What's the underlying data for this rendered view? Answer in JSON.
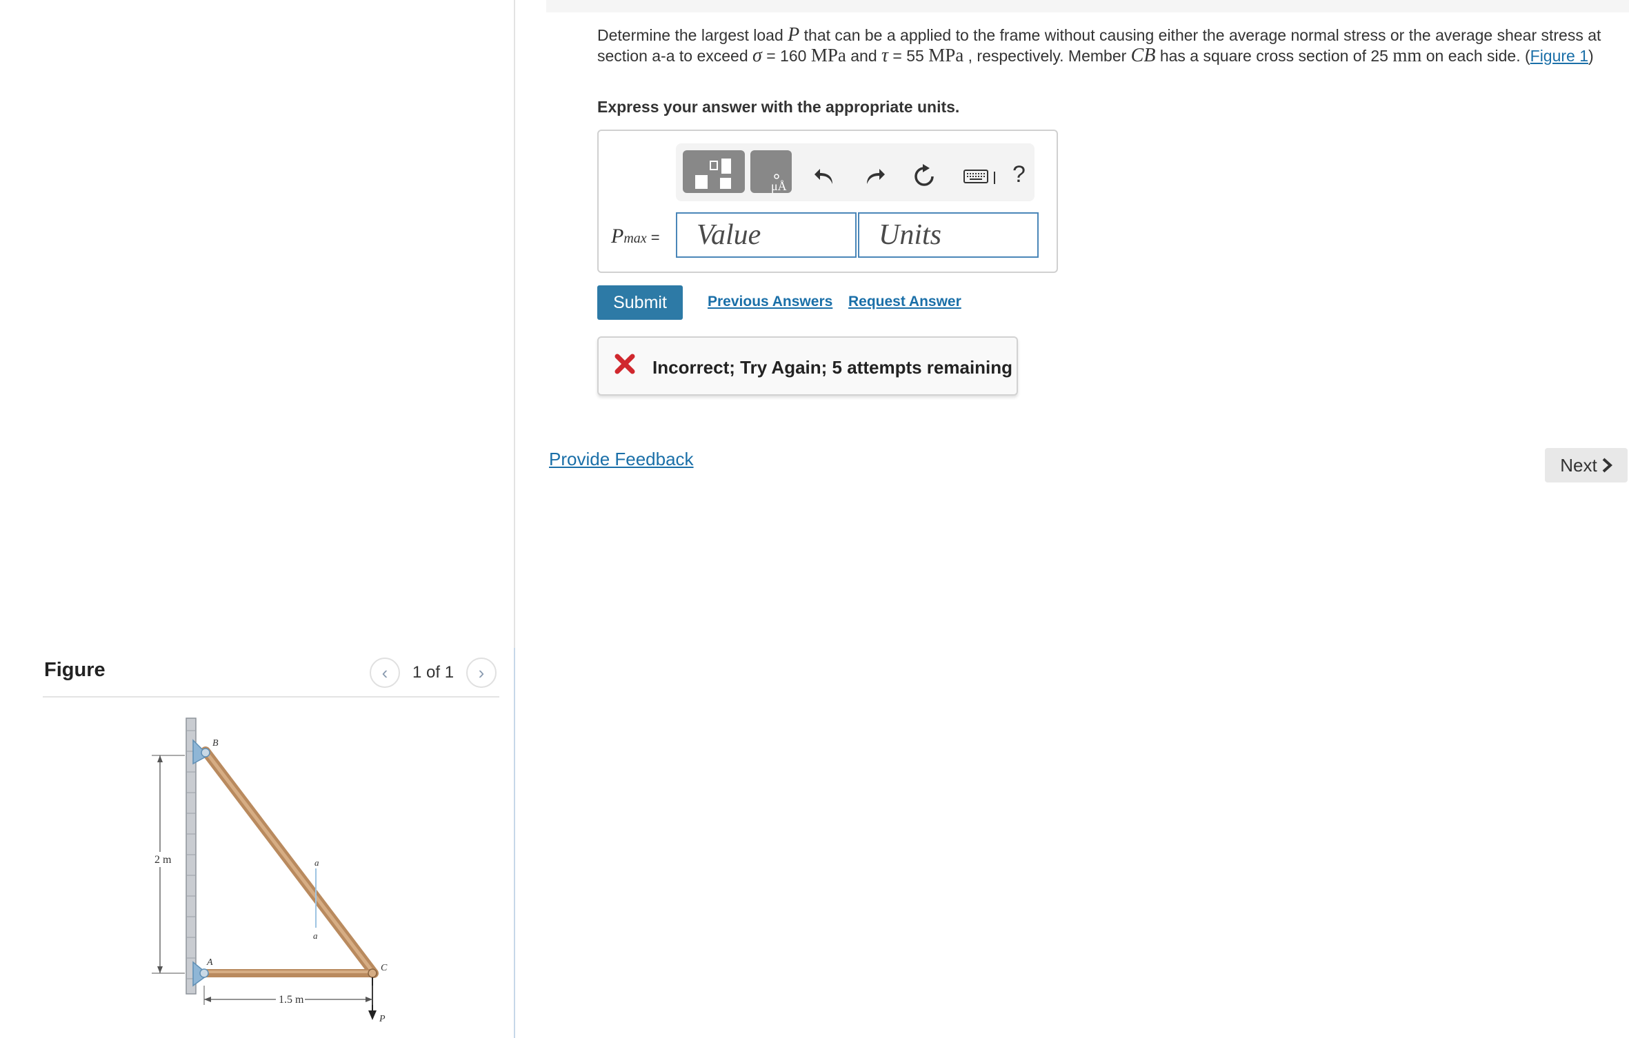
{
  "problem": {
    "t1": "Determine the largest load ",
    "sym_p": "P",
    "t2": " that can be a applied to the frame without causing either the average normal stress or the average shear stress at section a-a to exceed ",
    "sym_sigma": "σ",
    "t3": " = 160 ",
    "unit_mpa_1": "MPa",
    "t4": " and ",
    "sym_tau": "τ",
    "t5": " = 55 ",
    "unit_mpa_2": "MPa",
    "t6": " , respectively. Member ",
    "sym_cb": "CB",
    "t7": " has a square cross section of 25 ",
    "unit_mm": "mm",
    "t8": " on each side. (",
    "figure_link": "Figure 1",
    "t9": ")"
  },
  "instruction": "Express your answer with the appropriate units.",
  "toolbar": {
    "items": [
      "templates-icon",
      "units-icon",
      "undo-icon",
      "redo-icon",
      "reset-icon",
      "keyboard-icon",
      "help-icon"
    ],
    "help_label": "?"
  },
  "answer": {
    "label_symbol": "P",
    "label_subscript": "max",
    "label_equals": " =",
    "value_placeholder": "Value",
    "units_placeholder": "Units"
  },
  "actions": {
    "submit": "Submit",
    "previous_answers": "Previous Answers",
    "request_answer": "Request Answer"
  },
  "feedback": {
    "message": "Incorrect; Try Again; 5 attempts remaining",
    "status_color": "#d0282e"
  },
  "provide_feedback": "Provide Feedback",
  "next_label": "Next",
  "figure": {
    "title": "Figure",
    "counter": "1 of 1",
    "labels": {
      "b": "B",
      "a_point": "A",
      "c": "C",
      "p": "P",
      "height": "2 m",
      "width": "1.5 m",
      "section_top": "a",
      "section_bottom": "a"
    }
  },
  "colors": {
    "accent": "#2d7aa6",
    "link": "#1a6fa8",
    "member": "#b98a5e"
  }
}
